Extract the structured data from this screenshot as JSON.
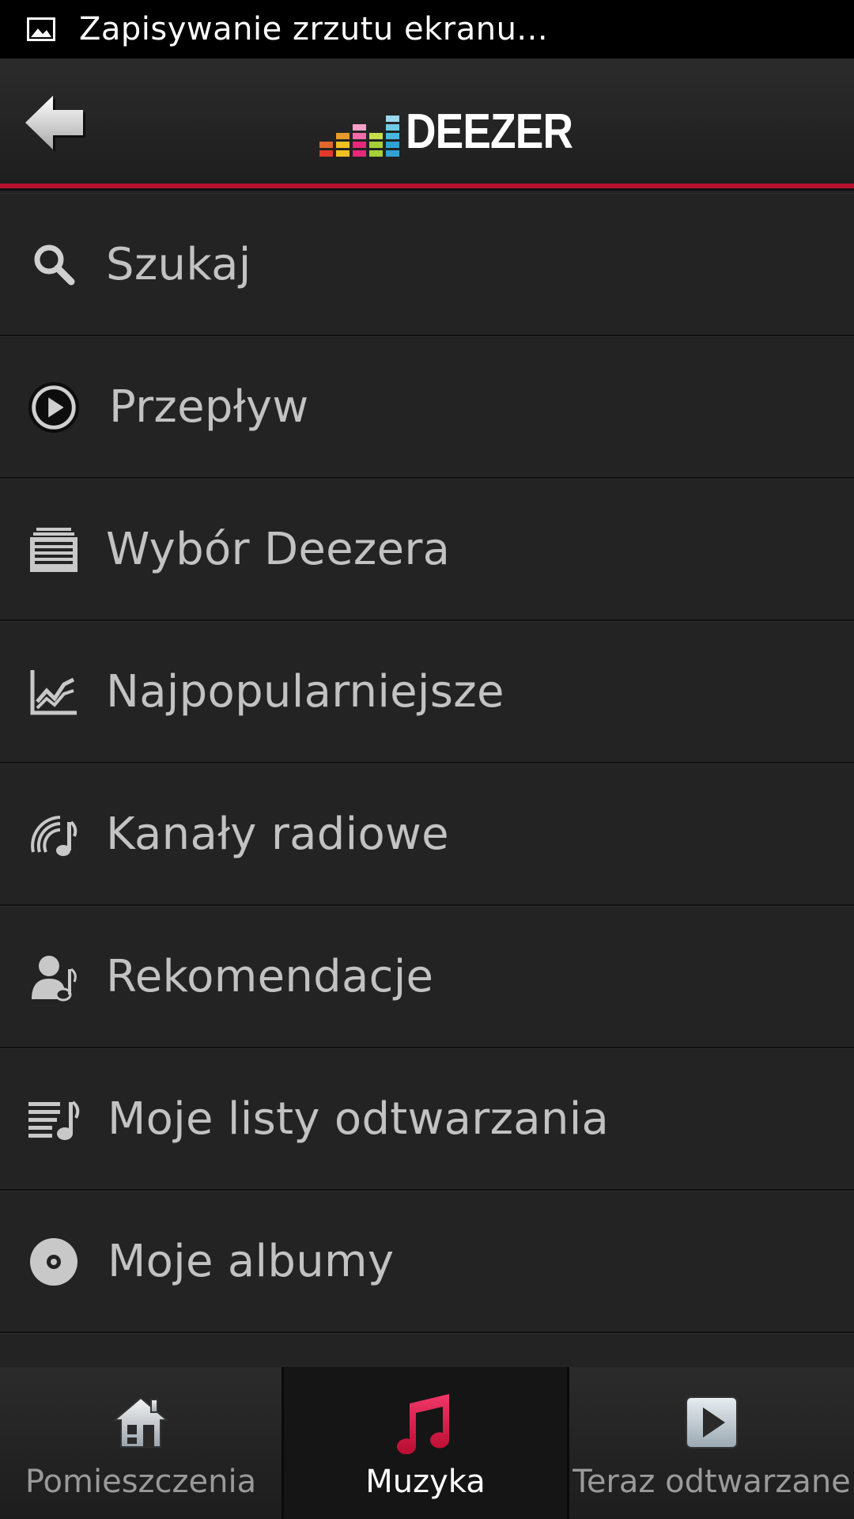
{
  "status_bar": {
    "icon": "image-icon",
    "text": "Zapisywanie zrzutu ekranu..."
  },
  "header": {
    "back_icon": "back-arrow-icon",
    "logo_text": "DEEZER",
    "accent_color": "#b8112d"
  },
  "menu": {
    "items": [
      {
        "icon": "search-icon",
        "label": "Szukaj"
      },
      {
        "icon": "play-circle-icon",
        "label": "Przepływ"
      },
      {
        "icon": "deezer-picks-icon",
        "label": "Wybór Deezera"
      },
      {
        "icon": "chart-icon",
        "label": "Najpopularniejsze"
      },
      {
        "icon": "radio-icon",
        "label": "Kanały radiowe"
      },
      {
        "icon": "recommendation-icon",
        "label": "Rekomendacje"
      },
      {
        "icon": "playlist-icon",
        "label": "Moje listy odtwarzania"
      },
      {
        "icon": "album-disc-icon",
        "label": "Moje albumy"
      }
    ]
  },
  "tabbar": {
    "tabs": [
      {
        "icon": "house-icon",
        "label": "Pomieszczenia",
        "active": false
      },
      {
        "icon": "music-note-icon",
        "label": "Muzyka",
        "active": true
      },
      {
        "icon": "play-icon",
        "label": "Teraz odtwarzane",
        "active": false
      }
    ],
    "active_icon_color": "#d8143f"
  }
}
